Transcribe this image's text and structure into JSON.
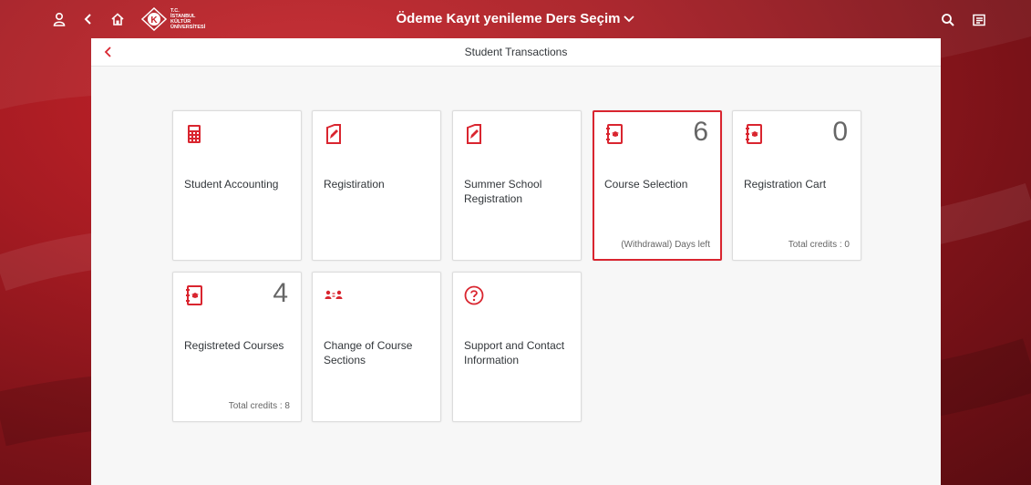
{
  "shell": {
    "title": "Ödeme Kayıt yenileme Ders Seçim",
    "logo_lines": [
      "T.C.",
      "İSTANBUL",
      "KÜLTÜR",
      "ÜNİVERSİTESİ"
    ]
  },
  "page": {
    "subheader_title": "Student Transactions"
  },
  "tiles": [
    {
      "label": "Student Accounting",
      "number": "",
      "footer": "",
      "icon": "calculator-icon"
    },
    {
      "label": "Registiration",
      "number": "",
      "footer": "",
      "icon": "edit-document-icon"
    },
    {
      "label": "Summer School Registration",
      "number": "",
      "footer": "",
      "icon": "edit-document-icon"
    },
    {
      "label": "Course Selection",
      "number": "6",
      "footer": "(Withdrawal) Days left",
      "icon": "course-book-icon"
    },
    {
      "label": "Registration Cart",
      "number": "0",
      "footer": "Total credits : 0",
      "icon": "course-book-icon"
    },
    {
      "label": "Registreted Courses",
      "number": "4",
      "footer": "Total credits : 8",
      "icon": "course-book-icon"
    },
    {
      "label": "Change of Course Sections",
      "number": "",
      "footer": "",
      "icon": "swap-people-icon"
    },
    {
      "label": "Support and Contact Information",
      "number": "",
      "footer": "",
      "icon": "question-circle-icon"
    }
  ],
  "colors": {
    "accent": "#d9252f",
    "brand_bg": "#a51b22"
  }
}
